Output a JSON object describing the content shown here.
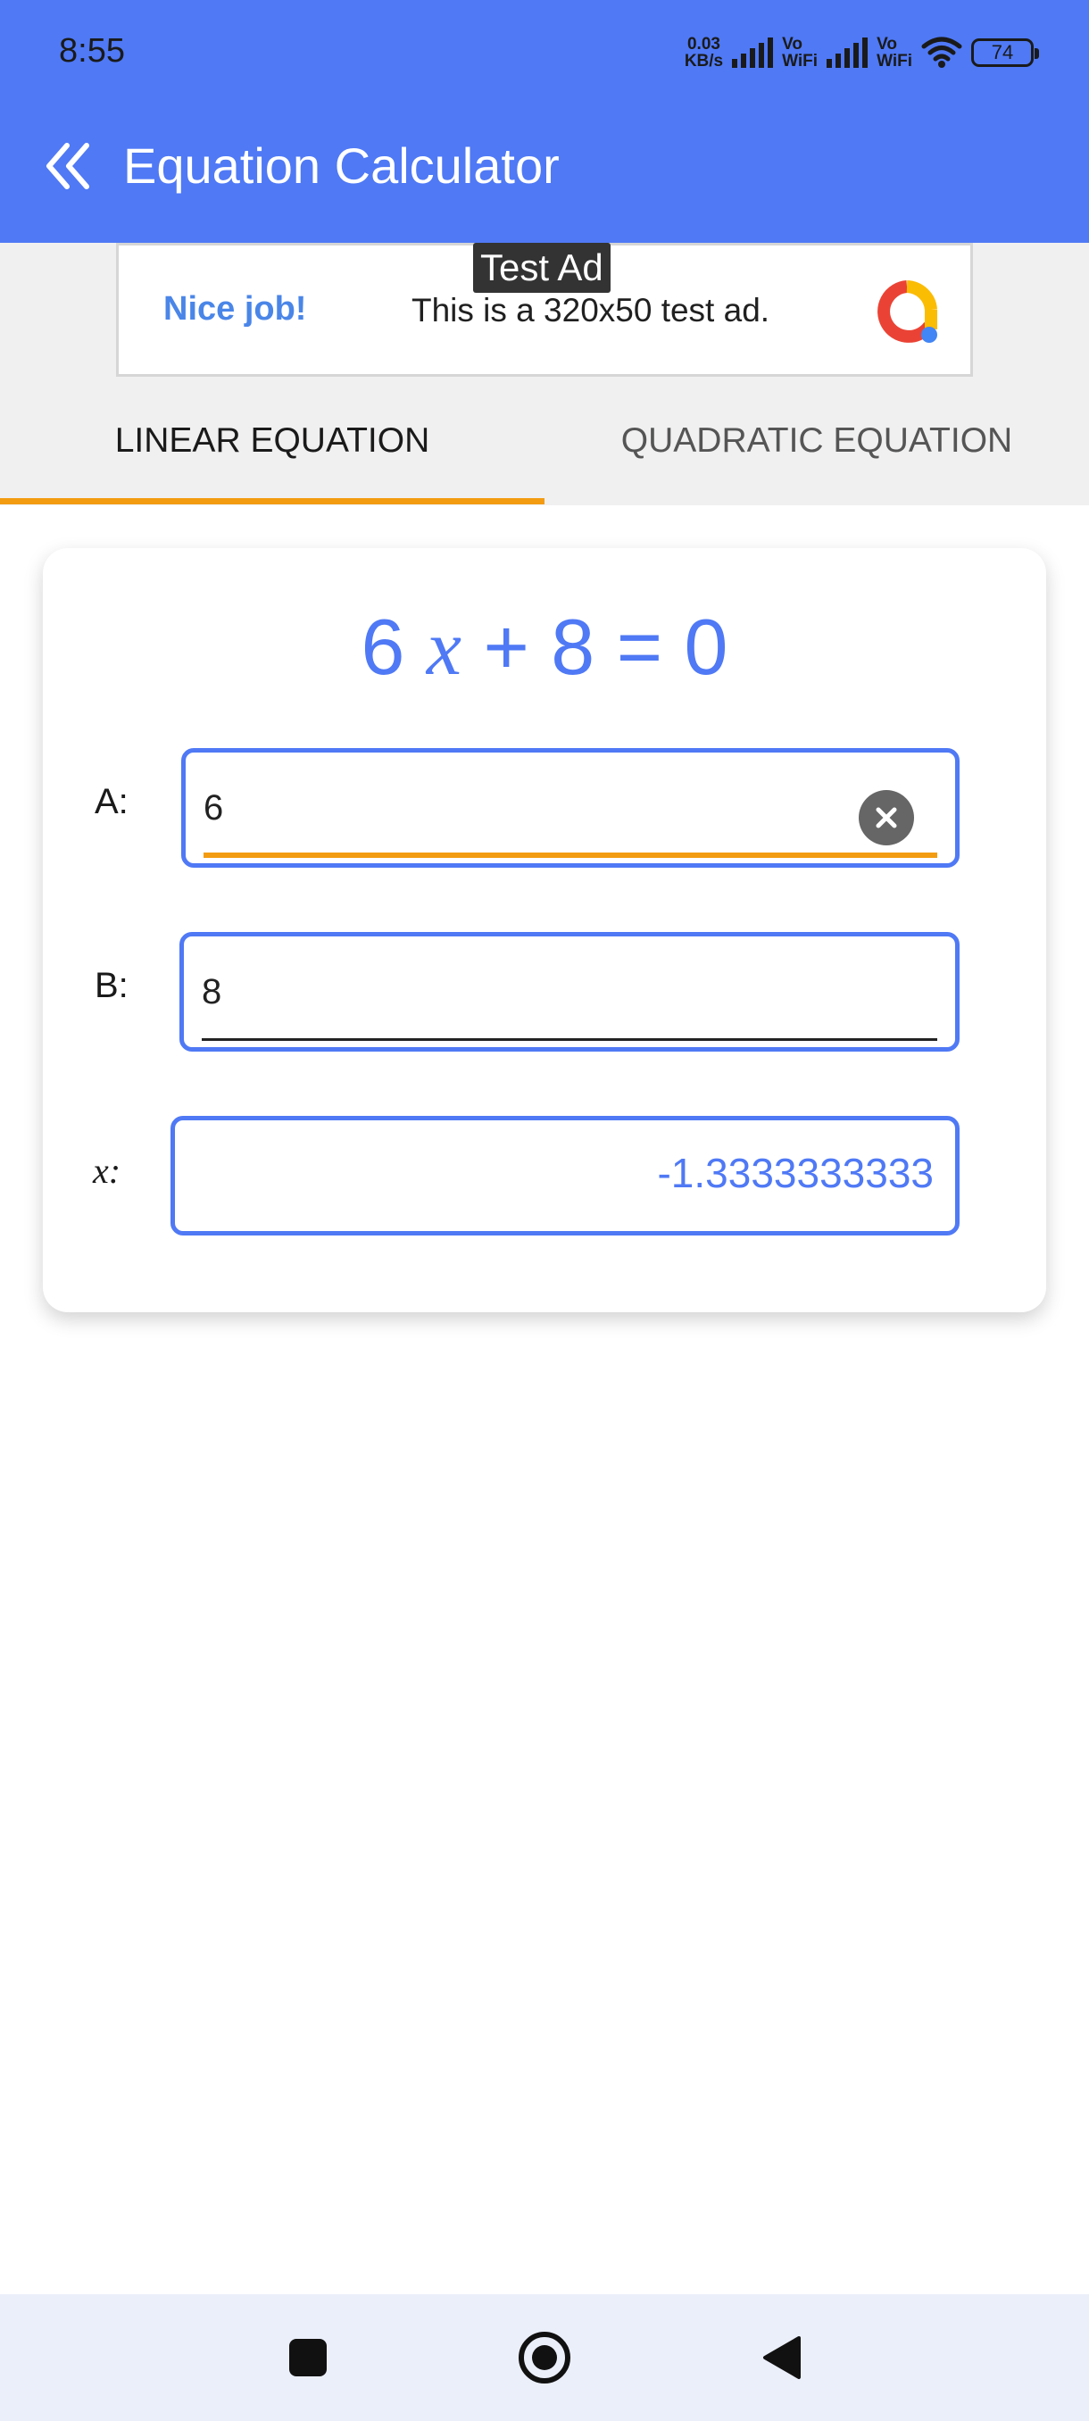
{
  "status_bar": {
    "time": "8:55",
    "net_speed_value": "0.03",
    "net_speed_unit": "KB/s",
    "vowifi_1_top": "Vo",
    "vowifi_1_bottom": "WiFi",
    "vowifi_2_top": "Vo",
    "vowifi_2_bottom": "WiFi",
    "battery": "74"
  },
  "app_bar": {
    "title": "Equation Calculator",
    "back_icon": "double-chevron-left-icon"
  },
  "ad": {
    "label": "Test Ad",
    "headline": "Nice job!",
    "text": "This is a 320x50 test ad."
  },
  "tabs": {
    "linear": "LINEAR EQUATION",
    "quadratic": "QUADRATIC EQUATION",
    "active": "linear",
    "indicator_color": "#f39c12"
  },
  "equation": {
    "a": "6",
    "var": "x",
    "plus": "+",
    "b": "8",
    "equals": "=",
    "rhs": "0"
  },
  "form": {
    "a_label": "A:",
    "a_value": "6",
    "b_label": "B:",
    "b_value": "8",
    "x_label": "x:",
    "x_result": "-1.3333333333"
  },
  "colors": {
    "primary": "#4f79f5",
    "accent": "#f39c12"
  },
  "nav": {
    "recents_icon": "square-icon",
    "home_icon": "circle-icon",
    "back_icon": "triangle-back-icon"
  }
}
